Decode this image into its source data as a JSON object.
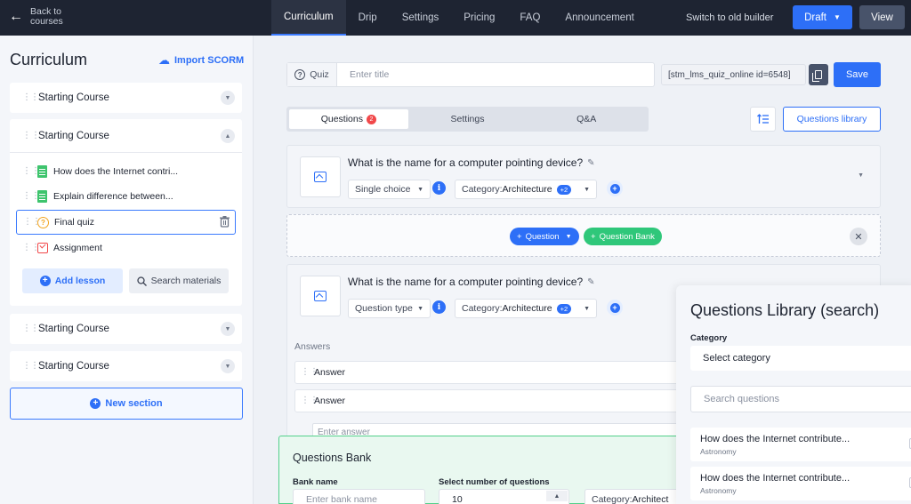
{
  "topbar": {
    "back_label": "Back to courses",
    "tabs": [
      "Curriculum",
      "Drip",
      "Settings",
      "Pricing",
      "FAQ",
      "Announcement"
    ],
    "active_tab": "Curriculum",
    "switch_label": "Switch to old builder",
    "draft_label": "Draft",
    "view_label": "View"
  },
  "sidebar": {
    "title": "Curriculum",
    "import_label": "Import SCORM",
    "sections": [
      {
        "label": "Starting Course"
      },
      {
        "label": "Starting Course"
      },
      {
        "label": "Starting Course"
      },
      {
        "label": "Starting Course"
      }
    ],
    "lessons": [
      {
        "label": "How does the Internet contri...",
        "icon": "document-icon"
      },
      {
        "label": "Explain difference between...",
        "icon": "document-icon"
      },
      {
        "label": "Final quiz",
        "icon": "quiz-icon"
      },
      {
        "label": "Assignment",
        "icon": "assignment-icon"
      }
    ],
    "add_lesson_label": "Add lesson",
    "search_materials_label": "Search materials",
    "new_section_label": "New section"
  },
  "quiz": {
    "type_label": "Quiz",
    "title_placeholder": "Enter title",
    "shortcode": "[stm_lms_quiz_online id=6548]",
    "save_label": "Save"
  },
  "tabs": {
    "questions_label": "Questions",
    "questions_badge": "2",
    "settings_label": "Settings",
    "qa_label": "Q&A",
    "library_button": "Questions library"
  },
  "questions": [
    {
      "title": "What is the name for a computer pointing device?",
      "type": "Single choice",
      "category_prefix": "Category:",
      "category": "Architecture",
      "extra": "+2"
    },
    {
      "title": "What is the name for a computer pointing device?",
      "type": "Question type",
      "category_prefix": "Category:",
      "category": "Architecture",
      "extra": "+2",
      "answers_label": "Answers",
      "answers": [
        "Answer",
        "Answer"
      ],
      "answer_placeholder": "Enter answer"
    }
  ],
  "add_row": {
    "question_label": "Question",
    "bank_label": "Question Bank"
  },
  "bank": {
    "title": "Questions Bank",
    "name_label": "Bank name",
    "name_placeholder": "Enter bank name",
    "number_label": "Select number of questions",
    "number_value": "10",
    "category_prefix": "Category:",
    "category_value": "Architect"
  },
  "library": {
    "title": "Questions Library (search)",
    "category_label": "Category",
    "category_placeholder": "Select category",
    "search_placeholder": "Search questions",
    "items": [
      {
        "title": "How does the Internet contribute...",
        "category": "Astronomy"
      },
      {
        "title": "How does the Internet contribute...",
        "category": "Astronomy"
      }
    ]
  },
  "colors": {
    "primary": "#2d6ff7",
    "topbar": "#1e2432",
    "bank_green": "#53d08b",
    "badge_red": "#f1484a"
  }
}
